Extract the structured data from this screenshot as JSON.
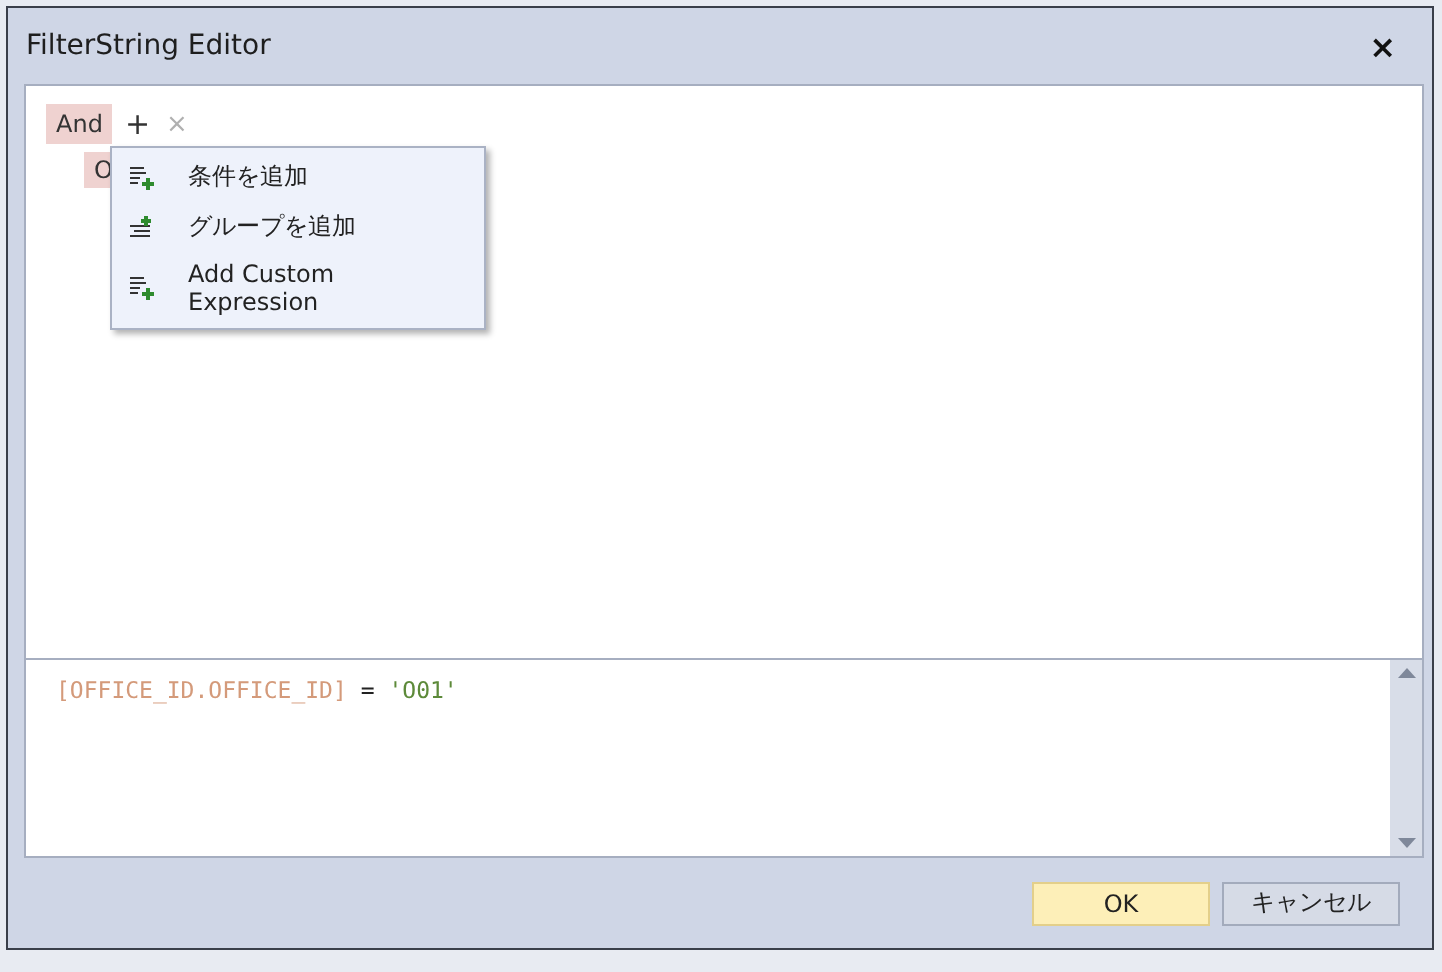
{
  "window": {
    "title": "FilterString Editor",
    "close": "×"
  },
  "tree": {
    "group": {
      "operator": "And",
      "add": "+",
      "remove": "×"
    },
    "child_label": "O"
  },
  "menu": {
    "items": [
      {
        "label": "条件を追加",
        "kind": "condition"
      },
      {
        "label": "グループを追加",
        "kind": "group"
      },
      {
        "label": "Add Custom Expression",
        "kind": "condition"
      }
    ]
  },
  "expression": {
    "field": "[OFFICE_ID.OFFICE_ID]",
    "operator": "=",
    "value": "'O01'"
  },
  "buttons": [
    {
      "label": "OK",
      "kind": "primary"
    },
    {
      "label": "キャンセル",
      "kind": "normal"
    }
  ]
}
